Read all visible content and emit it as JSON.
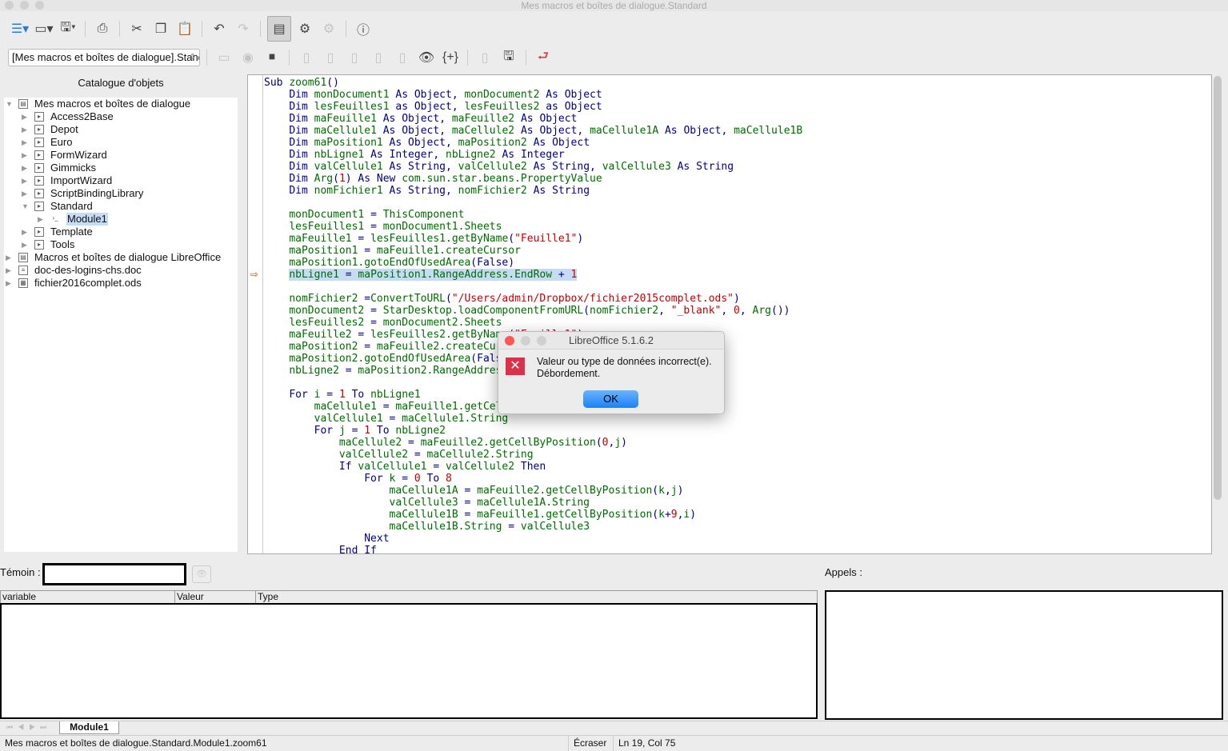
{
  "window": {
    "title": "Mes macros et boîtes de dialogue.Standard"
  },
  "toolbar": {
    "library_select": "[Mes macros et boîtes de dialogue].Standard"
  },
  "sidebar": {
    "title": "Catalogue d'objets",
    "tree": [
      {
        "label": "Mes macros et boîtes de dialogue",
        "level": 0,
        "expanded": true,
        "icon": "container-icon"
      },
      {
        "label": "Access2Base",
        "level": 1,
        "icon": "library-icon"
      },
      {
        "label": "Depot",
        "level": 1,
        "icon": "library-icon"
      },
      {
        "label": "Euro",
        "level": 1,
        "icon": "library-icon"
      },
      {
        "label": "FormWizard",
        "level": 1,
        "icon": "library-icon"
      },
      {
        "label": "Gimmicks",
        "level": 1,
        "icon": "library-icon"
      },
      {
        "label": "ImportWizard",
        "level": 1,
        "icon": "library-icon"
      },
      {
        "label": "ScriptBindingLibrary",
        "level": 1,
        "icon": "library-icon"
      },
      {
        "label": "Standard",
        "level": 1,
        "expanded": true,
        "icon": "library-icon"
      },
      {
        "label": "Module1",
        "level": 2,
        "selected": true,
        "icon": "module-icon"
      },
      {
        "label": "Template",
        "level": 1,
        "icon": "library-icon"
      },
      {
        "label": "Tools",
        "level": 1,
        "icon": "library-icon"
      },
      {
        "label": "Macros et boîtes de dialogue LibreOffice",
        "level": 0,
        "icon": "container-icon"
      },
      {
        "label": "doc-des-logins-chs.doc",
        "level": 0,
        "icon": "document-icon"
      },
      {
        "label": "fichier2016complet.ods",
        "level": 0,
        "icon": "spreadsheet-icon"
      }
    ]
  },
  "editor": {
    "current_line": 17,
    "lines": [
      "Sub zoom61()",
      "    Dim monDocument1 As Object, monDocument2 As Object",
      "    Dim lesFeuilles1 as Object, lesFeuilles2 as Object",
      "    Dim maFeuille1 As Object, maFeuille2 As Object",
      "    Dim maCellule1 As Object, maCellule2 As Object, maCellule1A As Object, maCellule1B",
      "    Dim maPosition1 As Object, maPosition2 As Object",
      "    Dim nbLigne1 As Integer, nbLigne2 As Integer",
      "    Dim valCellule1 As String, valCellule2 As String, valCellule3 As String",
      "    Dim Arg(1) As New com.sun.star.beans.PropertyValue",
      "    Dim nomFichier1 As String, nomFichier2 As String",
      "",
      "    monDocument1 = ThisComponent",
      "    lesFeuilles1 = monDocument1.Sheets",
      "    maFeuille1 = lesFeuilles1.getByName(\"Feuille1\")",
      "    maPosition1 = maFeuille1.createCursor",
      "    maPosition1.gotoEndOfUsedArea(False)",
      "    nbLigne1 = maPosition1.RangeAddress.EndRow + 1",
      "",
      "    nomFichier2 =ConvertToURL(\"/Users/admin/Dropbox/fichier2015complet.ods\")",
      "    monDocument2 = StarDesktop.loadComponentFromURL(nomFichier2, \"_blank\", 0, Arg())",
      "    lesFeuilles2 = monDocument2.Sheets",
      "    maFeuille2 = lesFeuilles2.getByName(\"Feuille1\")",
      "    maPosition2 = maFeuille2.createCursor",
      "    maPosition2.gotoEndOfUsedArea(False)",
      "    nbLigne2 = maPosition2.RangeAddress.EndRow + 1",
      "",
      "    For i = 1 To nbLigne1",
      "        maCellule1 = maFeuille1.getCellByPosition(0,i)",
      "        valCellule1 = maCellule1.String",
      "        For j = 1 To nbLigne2",
      "            maCellule2 = maFeuille2.getCellByPosition(0,j)",
      "            valCellule2 = maCellule2.String",
      "            If valCellule1 = valCellule2 Then",
      "                For k = 0 To 8",
      "                    maCellule1A = maFeuille2.getCellByPosition(k,j)",
      "                    valCellule3 = maCellule1A.String",
      "                    maCellule1B = maFeuille1.getCellByPosition(k+9,i)",
      "                    maCellule1B.String = valCellule3",
      "                Next",
      "            End If"
    ]
  },
  "dialog": {
    "title": "LibreOffice 5.1.6.2",
    "message_line1": "Valeur ou type de données incorrect(e).",
    "message_line2": "Débordement.",
    "ok_label": "OK"
  },
  "watch": {
    "label": "Témoin :",
    "value": "",
    "columns": [
      "variable",
      "Valeur",
      "Type"
    ]
  },
  "calls": {
    "label": "Appels :"
  },
  "tabs": [
    "Module1"
  ],
  "status": {
    "location": "Mes macros et boîtes de dialogue.Standard.Module1.zoom61",
    "mode": "Écraser",
    "position": "Ln 19, Col 75"
  },
  "colors": {
    "keyword": "#000080",
    "identifier": "#006b00",
    "literal": "#c00000",
    "highlight": "#c6dcf5",
    "ok_button": "#1a82fb"
  }
}
